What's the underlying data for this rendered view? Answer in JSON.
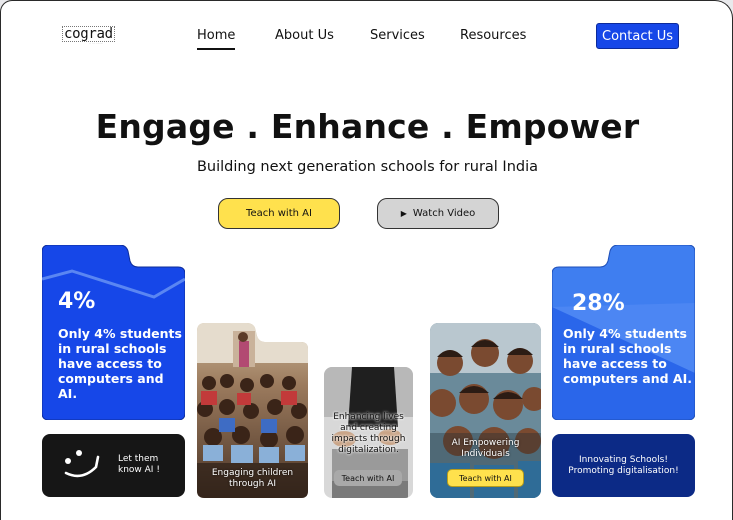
{
  "brand": {
    "name": "cograd",
    "tagline": "·· ··· ········"
  },
  "nav": {
    "home": "Home",
    "about": "About Us",
    "services": "Services",
    "resources": "Resources",
    "contact": "Contact Us"
  },
  "hero": {
    "title": "Engage . Enhance . Empower",
    "subtitle": "Building next generation schools for rural India",
    "teach_button": "Teach with AI",
    "watch_button": "Watch Video"
  },
  "stats": {
    "left": {
      "value": "4%",
      "text_lines": [
        "Only 4% students",
        "in rural schools",
        "have access to",
        "computers and AI."
      ]
    },
    "right": {
      "value": "28%",
      "text_lines": [
        "Only 4% students",
        "in rural schools",
        "have access to",
        "computers and AI."
      ]
    }
  },
  "cards": {
    "know_ai": [
      "Let them",
      "know AI !"
    ],
    "engaging": [
      "Engaging children",
      "through AI"
    ],
    "enhancing": [
      "Enhancing lives",
      "and creating",
      "impacts through",
      "digitalization."
    ],
    "enhancing_button": "Teach with AI",
    "empowering": [
      "AI Empowering",
      "Individuals"
    ],
    "empowering_button": "Teach with AI",
    "innovating": [
      "Innovating Schools!",
      "Promoting digitalisation!"
    ]
  },
  "colors": {
    "accent_blue": "#1647e8",
    "light_blue": "#3f7ef0",
    "navy": "#0c2a86",
    "yellow": "#ffe14d",
    "dark": "#161616"
  },
  "icons": [
    "play-icon",
    "smiley-icon"
  ]
}
